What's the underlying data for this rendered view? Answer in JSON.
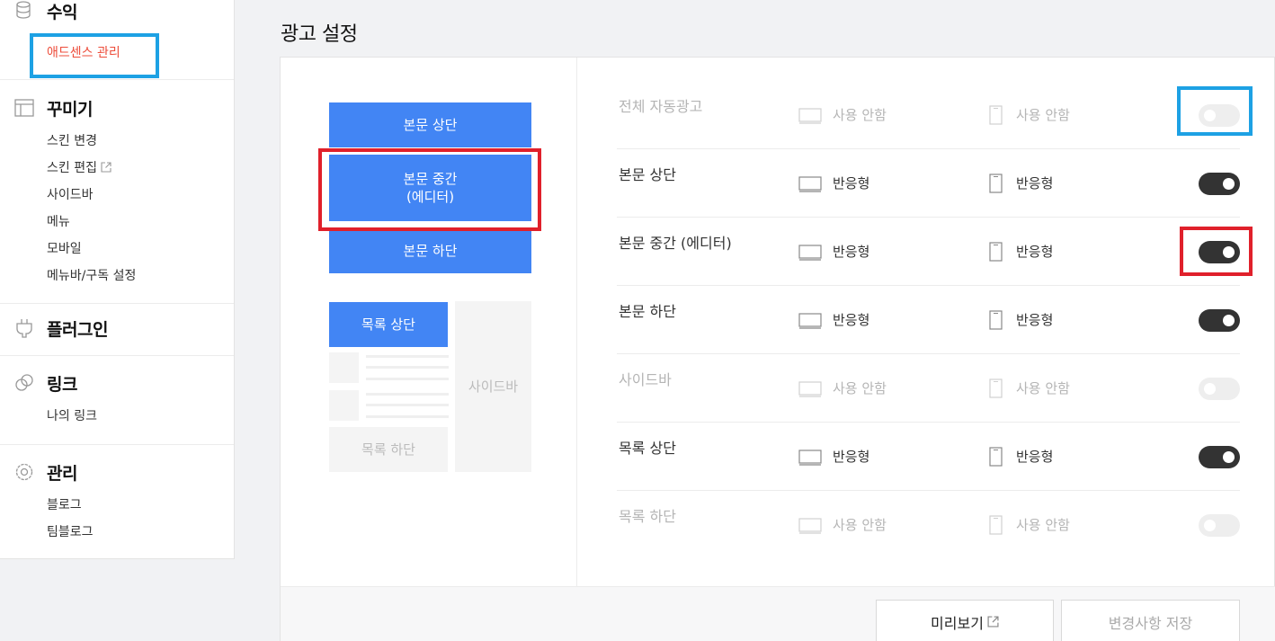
{
  "sidebar": {
    "revenue": {
      "title": "수익",
      "items": [
        "애드센스 관리"
      ]
    },
    "decorate": {
      "title": "꾸미기",
      "items": [
        "스킨 변경",
        "스킨 편집",
        "사이드바",
        "메뉴",
        "모바일",
        "메뉴바/구독 설정"
      ]
    },
    "plugin": {
      "title": "플러그인"
    },
    "link": {
      "title": "링크",
      "items": [
        "나의 링크"
      ]
    },
    "manage": {
      "title": "관리",
      "items": [
        "블로그",
        "팀블로그"
      ]
    }
  },
  "page": {
    "title": "광고 설정"
  },
  "preview": {
    "body_top": "본문 상단",
    "body_mid_line1": "본문 중간",
    "body_mid_line2": "(에디터)",
    "body_bottom": "본문 하단",
    "list_top": "목록 상단",
    "list_bottom": "목록 하단",
    "sidebar": "사이드바"
  },
  "settings": [
    {
      "name": "전체 자동광고",
      "pc": "사용 안함",
      "mobile": "사용 안함",
      "enabled": false
    },
    {
      "name": "본문 상단",
      "pc": "반응형",
      "mobile": "반응형",
      "enabled": true
    },
    {
      "name": "본문 중간 (에디터)",
      "pc": "반응형",
      "mobile": "반응형",
      "enabled": true
    },
    {
      "name": "본문 하단",
      "pc": "반응형",
      "mobile": "반응형",
      "enabled": true
    },
    {
      "name": "사이드바",
      "pc": "사용 안함",
      "mobile": "사용 안함",
      "enabled": false
    },
    {
      "name": "목록 상단",
      "pc": "반응형",
      "mobile": "반응형",
      "enabled": true
    },
    {
      "name": "목록 하단",
      "pc": "사용 안함",
      "mobile": "사용 안함",
      "enabled": false
    }
  ],
  "footer": {
    "preview_label": "미리보기",
    "save_label": "변경사항 저장"
  },
  "colors": {
    "accent_blue": "#4285f4",
    "active_menu": "#ed4d3b",
    "highlight_blue": "#1da1e4",
    "highlight_red": "#e0202b",
    "toggle_on": "#333333"
  },
  "icons": [
    "database-icon",
    "layout-icon",
    "plug-icon",
    "link-icon",
    "gear-icon",
    "external-link-icon",
    "monitor-icon",
    "mobile-icon"
  ]
}
